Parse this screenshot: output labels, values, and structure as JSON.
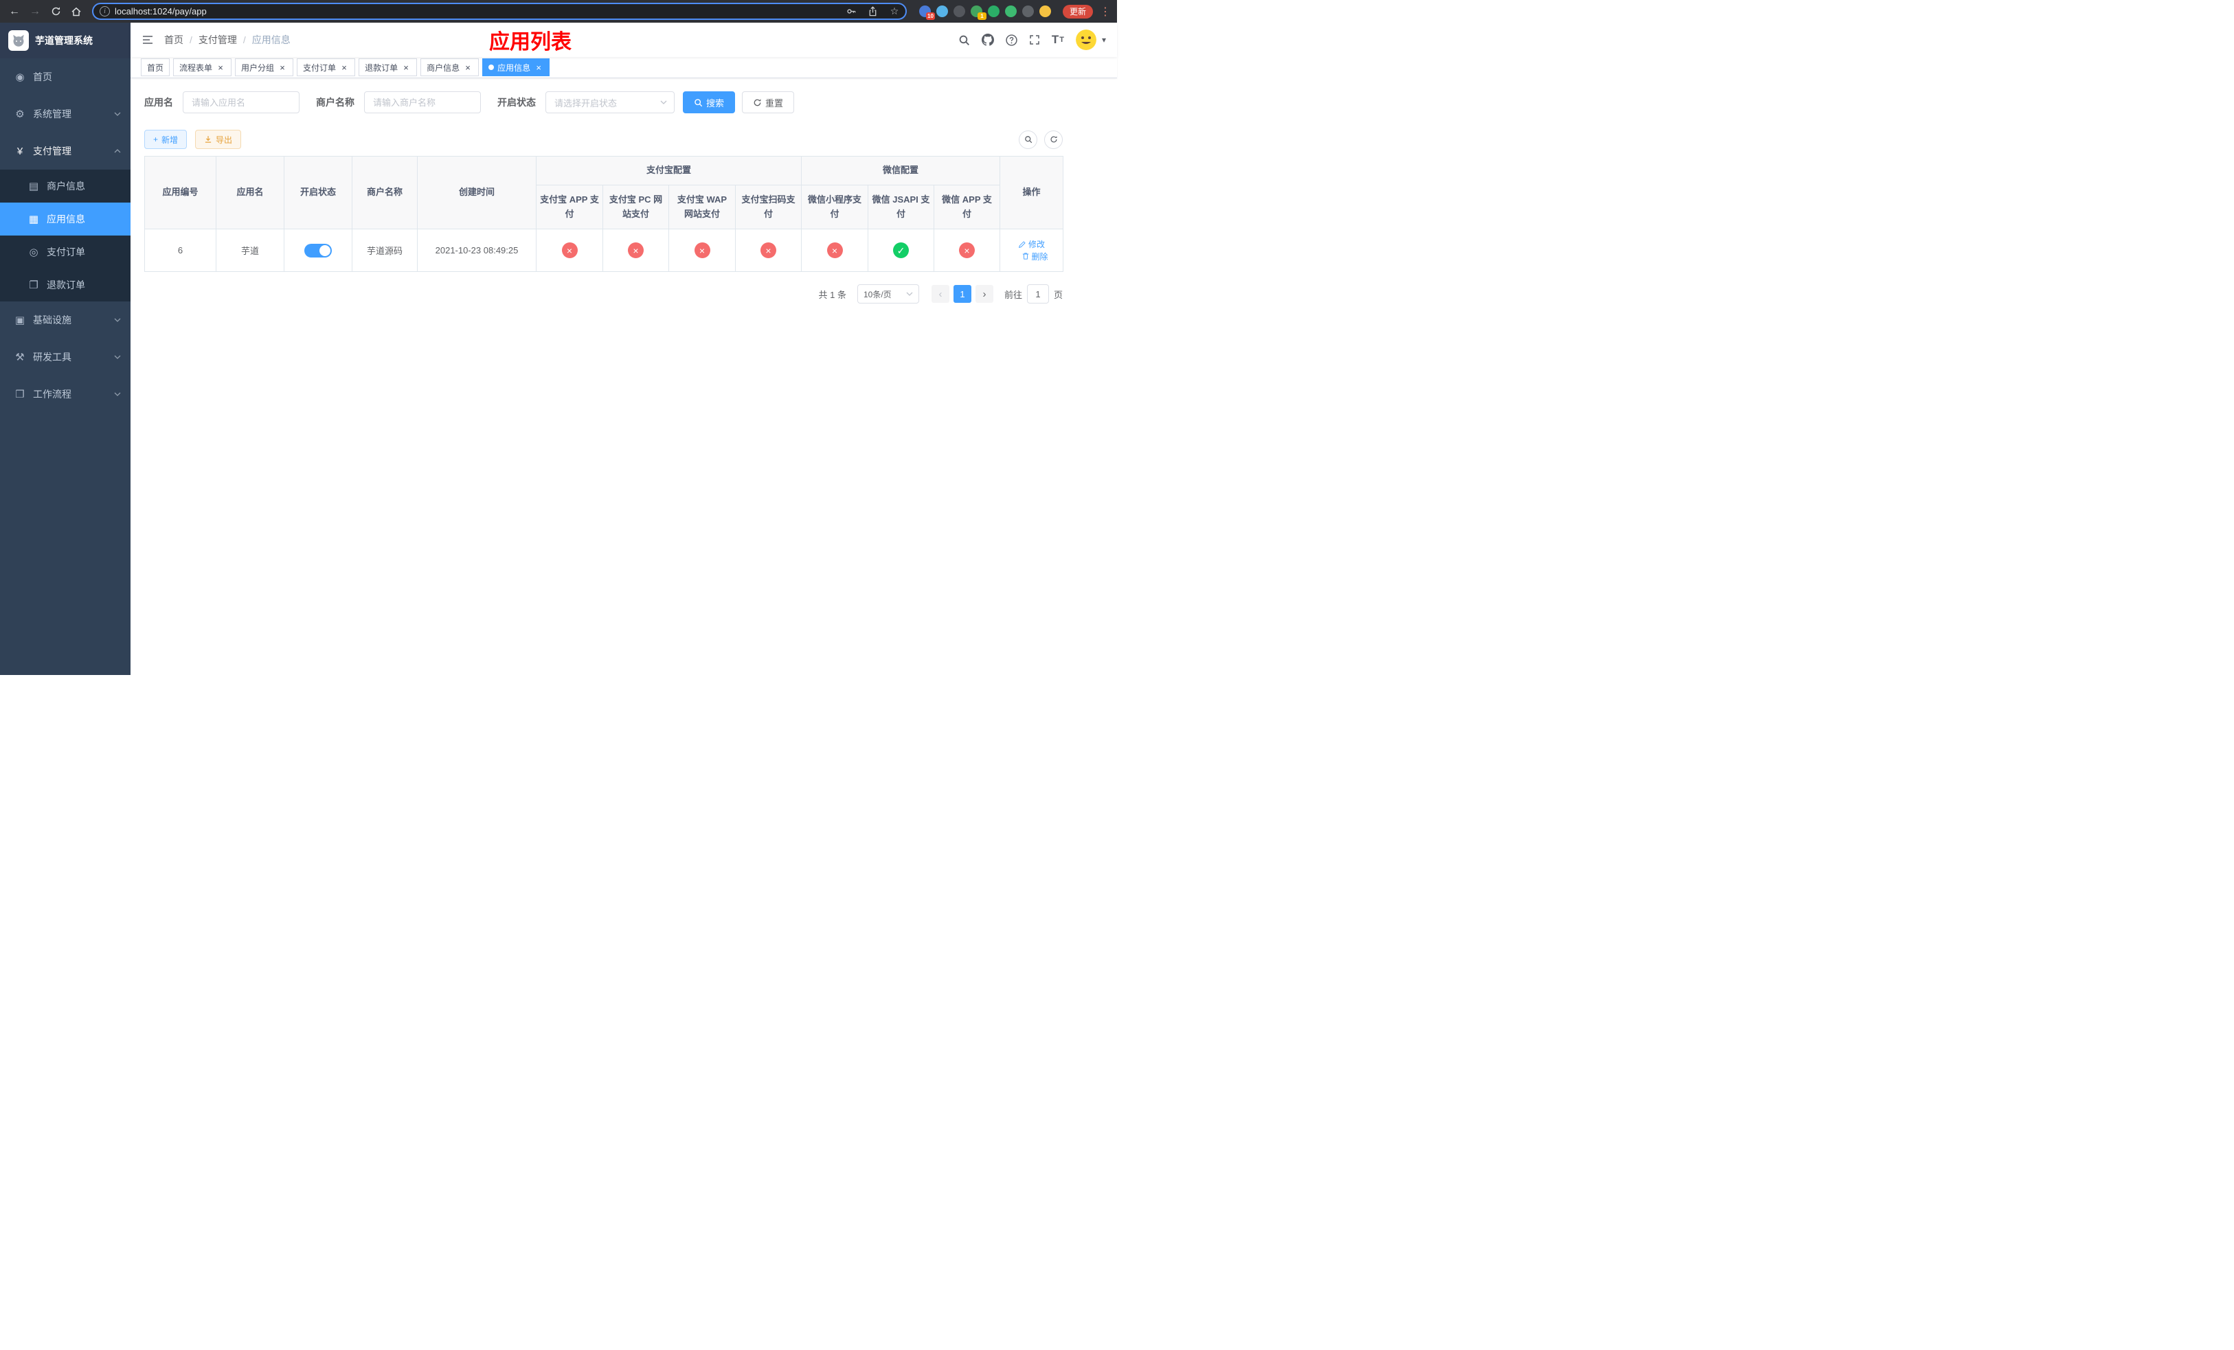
{
  "browser": {
    "url": "localhost:1024/pay/app",
    "update_label": "更新",
    "extensions": [
      {
        "name": "extension-blue-puzzle-icon",
        "color": "#4a7bd8",
        "badge": "10",
        "badge_color": "#e84335"
      },
      {
        "name": "extension-droplet-icon",
        "color": "#57b3e8"
      },
      {
        "name": "extension-dark-globe-icon",
        "color": "#54575d"
      },
      {
        "name": "extension-green-badged-icon",
        "color": "#43a55f",
        "badge": "1",
        "badge_color": "#f2b705"
      },
      {
        "name": "extension-wechat-icon",
        "color": "#2bae67"
      },
      {
        "name": "extension-green-doc-icon",
        "color": "#3dba71"
      },
      {
        "name": "extension-gray-puzzle-icon",
        "color": "#5f6368"
      },
      {
        "name": "extension-emoji-icon",
        "color": "#f5c242"
      }
    ]
  },
  "icons": {
    "back": "←",
    "forward": "→",
    "star": "☆",
    "info": "i",
    "kebab": "⋮",
    "caret_down": "▾",
    "check": "✓",
    "cross": "×",
    "plus": "+",
    "chevron_left": "‹",
    "chevron_right": "›",
    "font_large": "T",
    "font_small": "T"
  },
  "sidebar": {
    "title": "芋道管理系统",
    "items": [
      {
        "name": "sidebar-item-home",
        "label": "首页",
        "icon": "dashboard-icon",
        "glyph": "◉",
        "type": "top"
      },
      {
        "name": "sidebar-item-system",
        "label": "系统管理",
        "icon": "gear-icon",
        "glyph": "⚙",
        "type": "top",
        "chevron": "down"
      },
      {
        "name": "sidebar-item-payment",
        "label": "支付管理",
        "icon": "yen-icon",
        "glyph": "¥",
        "type": "top",
        "chevron": "up",
        "active": true
      },
      {
        "name": "sidebar-item-merchant-info",
        "label": "商户信息",
        "icon": "credit-card-icon",
        "glyph": "▤",
        "type": "sub"
      },
      {
        "name": "sidebar-item-app-info",
        "label": "应用信息",
        "icon": "app-grid-icon",
        "glyph": "▦",
        "type": "sub",
        "selected": true
      },
      {
        "name": "sidebar-item-pay-order",
        "label": "支付订单",
        "icon": "pay-order-icon",
        "glyph": "◎",
        "type": "sub"
      },
      {
        "name": "sidebar-item-refund-order",
        "label": "退款订单",
        "icon": "refund-order-icon",
        "glyph": "❐",
        "type": "sub"
      },
      {
        "name": "sidebar-item-infrastructure",
        "label": "基础设施",
        "icon": "infrastructure-icon",
        "glyph": "▣",
        "type": "top",
        "chevron": "down"
      },
      {
        "name": "sidebar-item-devtools",
        "label": "研发工具",
        "icon": "devtools-icon",
        "glyph": "⚒",
        "type": "top",
        "chevron": "down"
      },
      {
        "name": "sidebar-item-workflow",
        "label": "工作流程",
        "icon": "workflow-icon",
        "glyph": "❒",
        "type": "top",
        "chevron": "down"
      }
    ]
  },
  "header": {
    "breadcrumb": [
      "首页",
      "支付管理",
      "应用信息"
    ],
    "overlay_title": "应用列表"
  },
  "tabs": [
    {
      "name": "tab-home",
      "label": "首页",
      "closable": false,
      "active": false
    },
    {
      "name": "tab-process-form",
      "label": "流程表单",
      "closable": true,
      "active": false
    },
    {
      "name": "tab-user-group",
      "label": "用户分组",
      "closable": true,
      "active": false
    },
    {
      "name": "tab-pay-order",
      "label": "支付订单",
      "closable": true,
      "active": false
    },
    {
      "name": "tab-refund-order",
      "label": "退款订单",
      "closable": true,
      "active": false
    },
    {
      "name": "tab-merchant-info",
      "label": "商户信息",
      "closable": true,
      "active": false
    },
    {
      "name": "tab-app-info",
      "label": "应用信息",
      "closable": true,
      "active": true
    }
  ],
  "filters": {
    "app_name_label": "应用名",
    "app_name_placeholder": "请输入应用名",
    "merchant_label": "商户名称",
    "merchant_placeholder": "请输入商户名称",
    "status_label": "开启状态",
    "status_placeholder": "请选择开启状态",
    "search_button": "搜索",
    "reset_button": "重置"
  },
  "toolbar": {
    "add_button": "新增",
    "export_button": "导出"
  },
  "table": {
    "plain_columns": [
      "应用编号",
      "应用名",
      "开启状态",
      "商户名称",
      "创建时间"
    ],
    "groups": [
      {
        "label": "支付宝配置",
        "children": [
          "支付宝 APP 支付",
          "支付宝 PC 网站支付",
          "支付宝 WAP 网站支付",
          "支付宝扫码支付"
        ]
      },
      {
        "label": "微信配置",
        "children": [
          "微信小程序支付",
          "微信 JSAPI 支付",
          "微信 APP 支付"
        ]
      }
    ],
    "action_column": "操作",
    "rows": [
      {
        "app_id": "6",
        "app_name": "芋道",
        "enabled": true,
        "merchant_name": "芋道源码",
        "create_time": "2021-10-23 08:49:25",
        "pay_configs": [
          false,
          false,
          false,
          false,
          false,
          true,
          false
        ],
        "edit_label": "修改",
        "delete_label": "删除"
      }
    ]
  },
  "pagination": {
    "total_text": "共 1 条",
    "page_size_text": "10条/页",
    "pages": [
      "1"
    ],
    "active_page": "1",
    "jump_prefix": "前往",
    "jump_value": "1",
    "jump_suffix": "页"
  }
}
